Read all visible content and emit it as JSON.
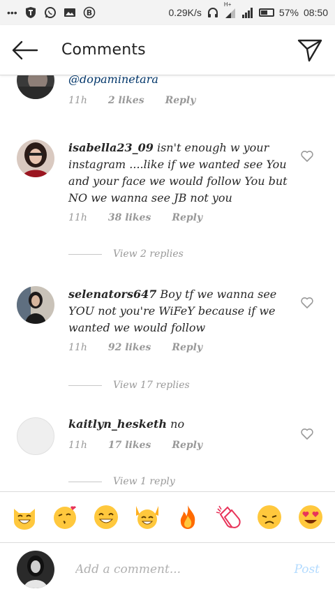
{
  "status_bar": {
    "more": "•••",
    "net_speed": "0.29K/s",
    "net_type": "H+",
    "battery_pct": "57%",
    "battery_level": 57,
    "time": "08:50"
  },
  "header": {
    "title": "Comments"
  },
  "comments": [
    {
      "username": "",
      "text": "@dopaminetara",
      "time": "11h",
      "likes": "2 likes",
      "reply": "Reply"
    },
    {
      "username": "isabella23_09",
      "text": " isn't  enough w your instagram ....like if we wanted see You and your face we would follow You but NO we wanna see JB not you",
      "time": "11h",
      "likes": "38 likes",
      "reply": "Reply",
      "view_replies": "View 2 replies"
    },
    {
      "username": "selenators647",
      "text": " Boy tf we wanna see YOU not you're WiFeY because if we wanted we would follow",
      "time": "11h",
      "likes": "92 likes",
      "reply": "Reply",
      "view_replies": "View 17 replies"
    },
    {
      "username": "kaitlyn_hesketh",
      "text": " no",
      "time": "11h",
      "likes": "17 likes",
      "reply": "Reply",
      "view_replies": "View 1 reply"
    }
  ],
  "emoji_bar": [
    "grinning-cat",
    "kissing-heart",
    "smile",
    "raising-hands",
    "fire",
    "clapping-hands",
    "disappointed",
    "heart-eyes"
  ],
  "composer": {
    "placeholder": "Add a comment...",
    "post_label": "Post"
  },
  "colors": {
    "link": "#003569",
    "muted": "#999999",
    "post_disabled": "#b3dbff",
    "emoji_yellow": "#ffc83d"
  }
}
